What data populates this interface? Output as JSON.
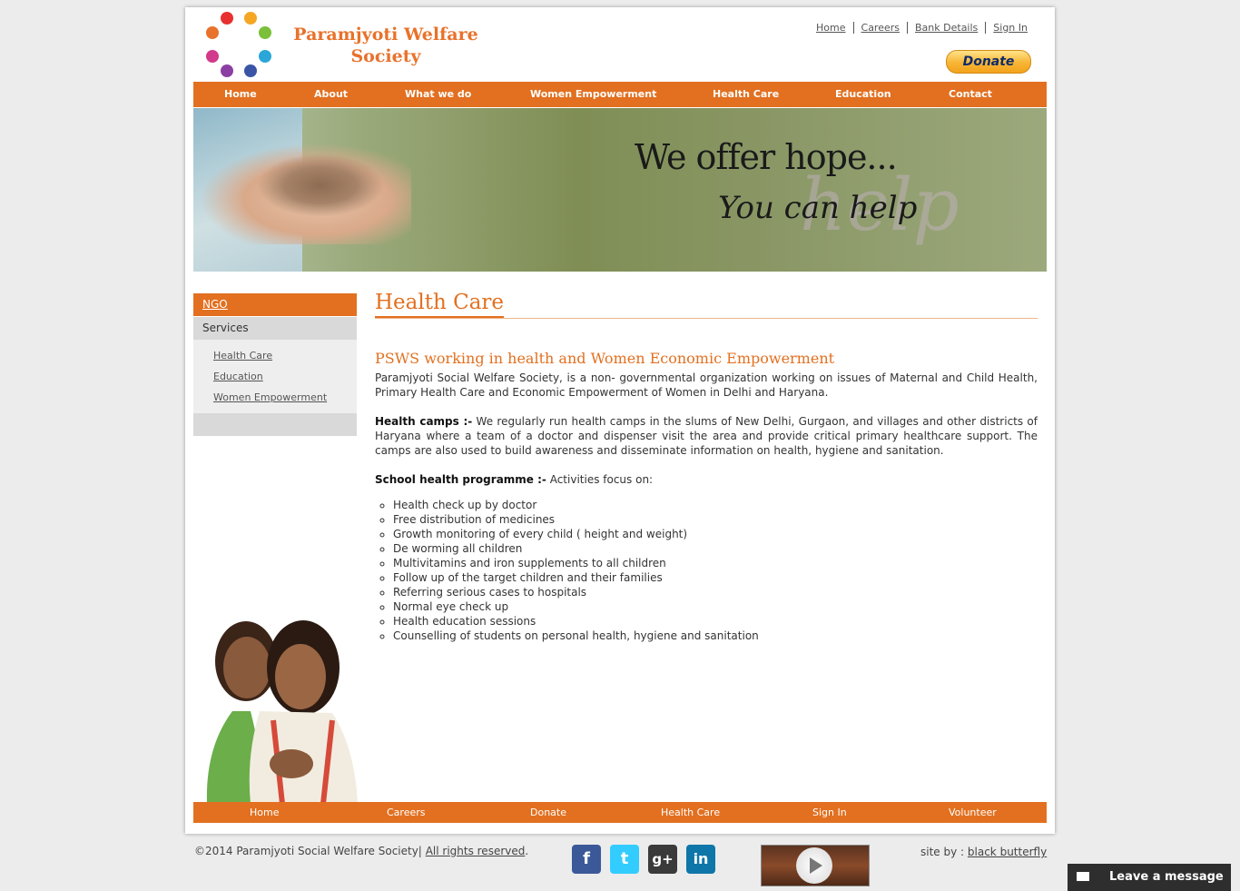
{
  "header": {
    "logo_line1": "Paramjyoti Welfare",
    "logo_line2": "Society",
    "top_links": [
      "Home",
      "Careers",
      "Bank Details",
      "Sign In"
    ],
    "donate_label": "Donate"
  },
  "main_nav": [
    "Home",
    "About",
    "What we do",
    "Women Empowerment",
    "Health Care",
    "Education",
    "Contact"
  ],
  "banner": {
    "line1": "We offer hope...",
    "line2": "You can help",
    "watermark": "help"
  },
  "sidebar": {
    "heading": "NGO",
    "section": "Services",
    "items": [
      "Health Care",
      "Education",
      "Women Empowerment"
    ]
  },
  "content": {
    "title": "Health Care",
    "subtitle": "PSWS working in health and Women Economic Empowerment",
    "intro": "Paramjyoti Social Welfare Society, is a non- governmental organization working on issues of Maternal and Child Health, Primary Health Care and Economic Empowerment of Women in Delhi and Haryana.",
    "camps_label": "Health camps :-",
    "camps_text": " We regularly run health camps in the slums of New Delhi, Gurgaon, and villages and other districts of Haryana where a team of a doctor and dispenser visit the area and provide critical primary healthcare support. The camps are also used to build awareness and disseminate information on health, hygiene and sanitation.",
    "school_label": "School health programme :-",
    "school_text": " Activities focus on:",
    "activities": [
      "Health check up by doctor",
      "Free distribution of medicines",
      "Growth monitoring of every child ( height and weight)",
      "De worming all children",
      "Multivitamins and iron supplements to all children",
      "Follow up of the target children and their families",
      "Referring serious cases to hospitals",
      "Normal eye check up",
      "Health education sessions",
      "Counselling of students on personal health, hygiene and sanitation"
    ]
  },
  "footer_nav": [
    "Home",
    "Careers",
    "Donate",
    "Health Care",
    "Sign In",
    "Volunteer"
  ],
  "footer": {
    "copyright": "©2014 Paramjyoti Social Welfare Society|",
    "rights": "All rights reserved",
    "period": ".",
    "site_by": "site by :",
    "credit": "black butterfly",
    "leave_message": "Leave a message"
  },
  "colors": {
    "accent": "#e27020",
    "facebook": "#3b5998",
    "twitter": "#33ccff",
    "googleplus": "#3a3a3a",
    "linkedin": "#0e76a8"
  },
  "icons": [
    "facebook-icon",
    "twitter-icon",
    "google-plus-icon",
    "linkedin-icon",
    "play-icon",
    "envelope-icon"
  ]
}
